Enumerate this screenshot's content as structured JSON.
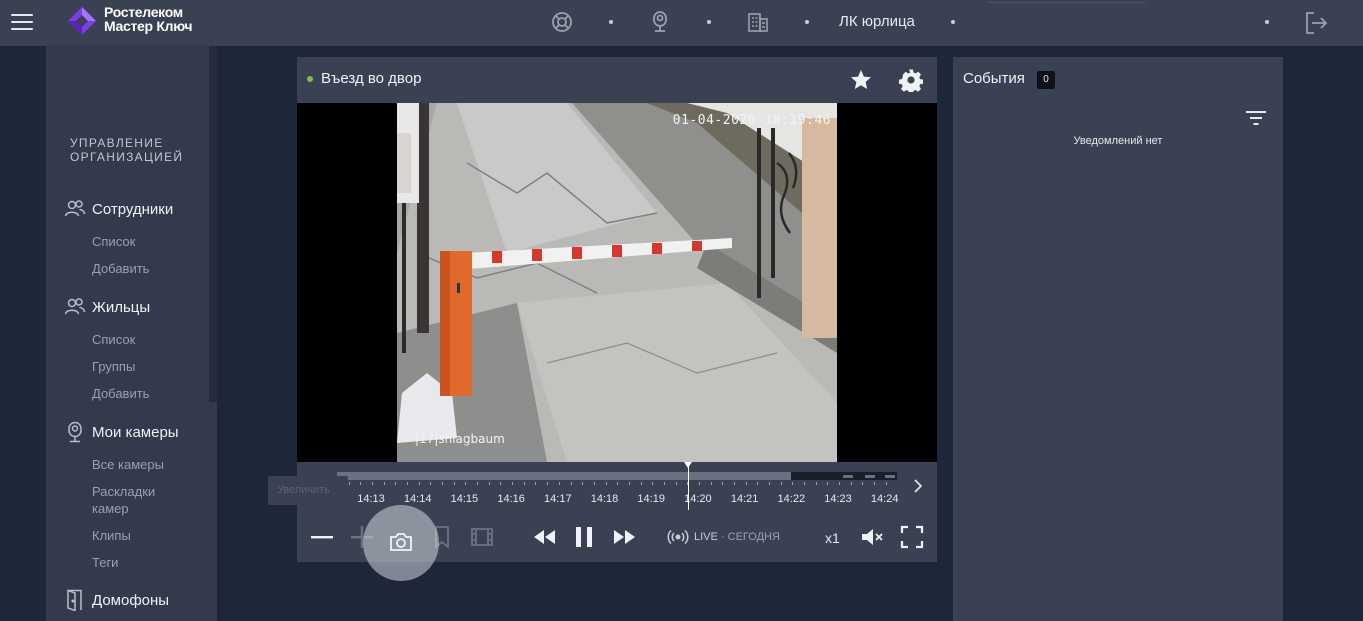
{
  "header": {
    "brand_line1": "Ростелеком",
    "brand_line2": "Мастер Ключ",
    "org_title": "ЛК юрлица",
    "icons": [
      "menu-icon",
      "support-icon",
      "intercom-icon",
      "building-icon",
      "logout-icon"
    ]
  },
  "sidebar": {
    "heading_line1": "УПРАВЛЕНИЕ",
    "heading_line2": "ОРГАНИЗАЦИЕЙ",
    "employees": {
      "label": "Сотрудники",
      "items": [
        "Список",
        "Добавить"
      ]
    },
    "residents": {
      "label": "Жильцы",
      "items": [
        "Список",
        "Группы",
        "Добавить"
      ]
    },
    "cameras": {
      "label": "Мои камеры",
      "items": [
        "Все камеры",
        "Раскладки камер",
        "Клипы",
        "Теги"
      ]
    },
    "intercoms": {
      "label": "Домофоны"
    }
  },
  "camera": {
    "title": "Въезд во двор",
    "status_color": "#7ac143",
    "osd_timestamp": "01-04-2020 18:19:46",
    "osd_name": "|17|shlagbaum",
    "timeline": {
      "labels": [
        "14:13",
        "14:14",
        "14:15",
        "14:16",
        "14:17",
        "14:18",
        "14:19",
        "14:20",
        "14:21",
        "14:22",
        "14:23",
        "14:24"
      ],
      "recorded_fraction": 0.81,
      "cursor_label": "14:20"
    },
    "controls": {
      "tooltip": "Увеличить",
      "live_label": "LIVE",
      "live_suffix": "· СЕГОДНЯ",
      "speed": "x1"
    }
  },
  "events": {
    "title": "События",
    "count": "0",
    "empty_message": "Уведомлений нет"
  }
}
